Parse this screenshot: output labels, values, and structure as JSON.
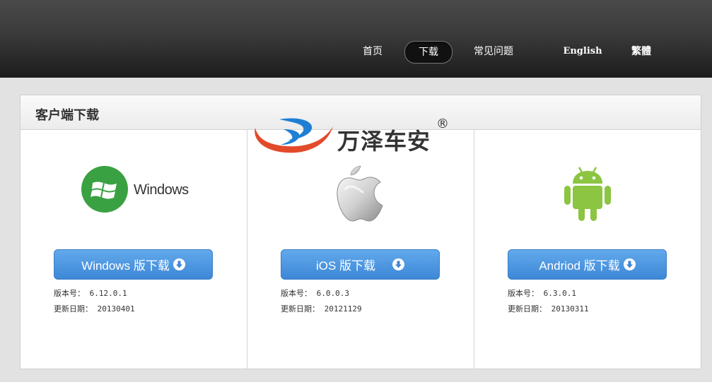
{
  "nav": {
    "items": [
      {
        "label": "首页"
      },
      {
        "label": "下载"
      },
      {
        "label": "常见问题"
      },
      {
        "label": "English"
      },
      {
        "label": "繁體"
      }
    ]
  },
  "panel": {
    "title": "客户端下载"
  },
  "watermark": {
    "text": "万泽车安",
    "reg": "®"
  },
  "downloads": [
    {
      "logo_icon": "windows-logo-icon",
      "logo_text": "Windows",
      "button_label": "Windows 版下载",
      "version_label": "版本号：",
      "version": "6.12.0.1",
      "date_label": "更新日期：",
      "date": "20130401"
    },
    {
      "logo_icon": "apple-logo-icon",
      "button_label": "iOS 版下载",
      "version_label": "版本号：",
      "version": "6.0.0.3",
      "date_label": "更新日期：",
      "date": "20121129"
    },
    {
      "logo_icon": "android-logo-icon",
      "button_label": "Andriod 版下载",
      "version_label": "版本号：",
      "version": "6.3.0.1",
      "date_label": "更新日期：",
      "date": "20130311"
    }
  ],
  "colors": {
    "button": "#4a95e0",
    "windows_green": "#3aa142",
    "android_green": "#8bc541"
  }
}
